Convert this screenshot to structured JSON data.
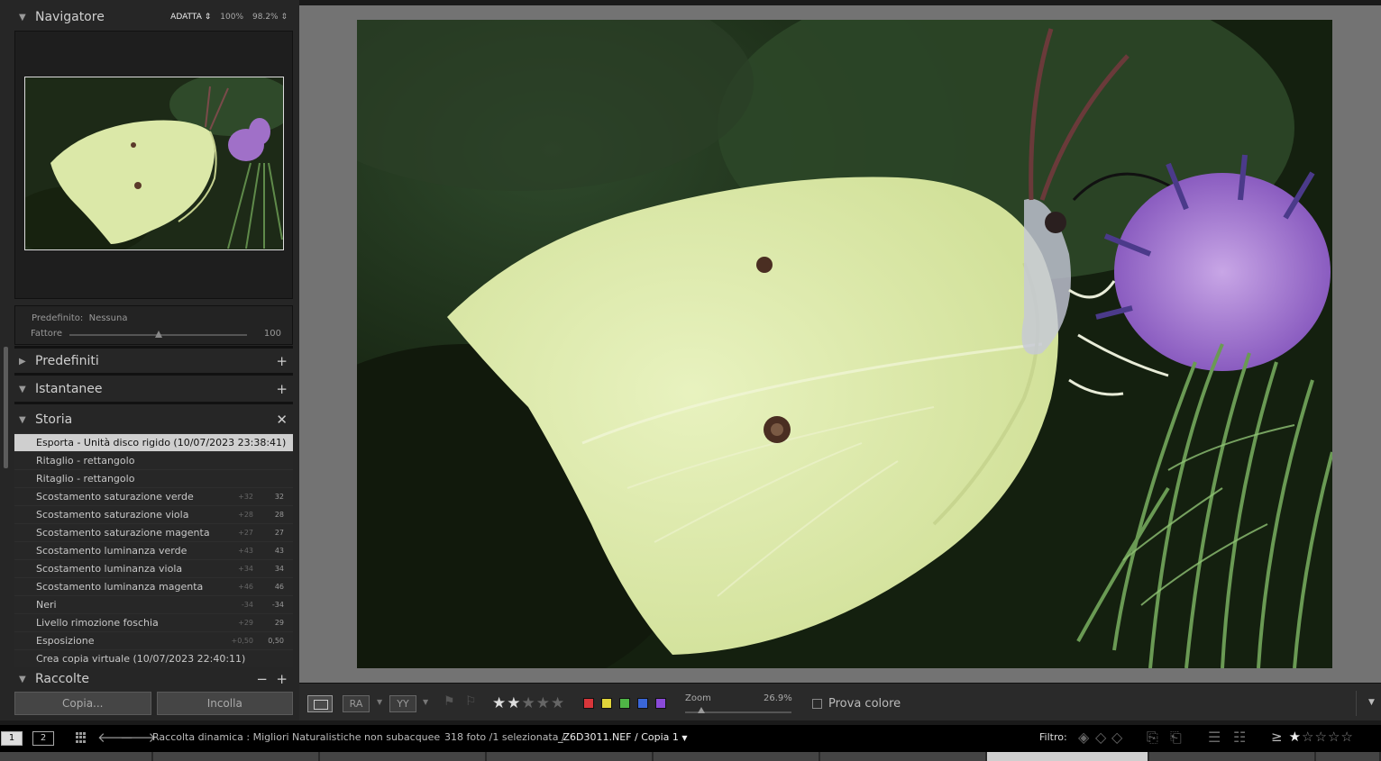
{
  "navigator": {
    "title": "Navigatore",
    "opt_fit": "ADATTA",
    "opt_100": "100%",
    "opt_zoom": "98.2%"
  },
  "preset_adjust": {
    "preset_label": "Predefinito:",
    "preset_value": "Nessuna",
    "amount_label": "Fattore",
    "amount_value": "100"
  },
  "panels": {
    "presets": "Predefiniti",
    "snapshots": "Istantanee",
    "history": "Storia",
    "collections": "Raccolte"
  },
  "history": [
    {
      "label": "Esporta - Unità disco rigido (10/07/2023 23:38:41)",
      "delta": "",
      "value": "",
      "selected": true
    },
    {
      "label": "Ritaglio - rettangolo",
      "delta": "",
      "value": ""
    },
    {
      "label": "Ritaglio - rettangolo",
      "delta": "",
      "value": ""
    },
    {
      "label": "Scostamento saturazione verde",
      "delta": "+32",
      "value": "32"
    },
    {
      "label": "Scostamento saturazione viola",
      "delta": "+28",
      "value": "28"
    },
    {
      "label": "Scostamento saturazione magenta",
      "delta": "+27",
      "value": "27"
    },
    {
      "label": "Scostamento luminanza verde",
      "delta": "+43",
      "value": "43"
    },
    {
      "label": "Scostamento luminanza viola",
      "delta": "+34",
      "value": "34"
    },
    {
      "label": "Scostamento luminanza magenta",
      "delta": "+46",
      "value": "46"
    },
    {
      "label": "Neri",
      "delta": "-34",
      "value": "-34"
    },
    {
      "label": "Livello rimozione foschia",
      "delta": "+29",
      "value": "29"
    },
    {
      "label": "Esposizione",
      "delta": "+0,50",
      "value": "0,50"
    },
    {
      "label": "Crea copia virtuale (10/07/2023 22:40:11)",
      "delta": "",
      "value": ""
    }
  ],
  "buttons": {
    "copy": "Copia...",
    "paste": "Incolla"
  },
  "toolbar": {
    "view_ra": "RA",
    "view_yy": "YY",
    "rating": 2,
    "rating_max": 5,
    "zoom_label": "Zoom",
    "zoom_value": "26.9%",
    "zoom_fraction": 0.15,
    "soft_proof": "Prova colore",
    "color_labels": [
      "#d8363a",
      "#e0d43a",
      "#4fb446",
      "#3a66d8",
      "#8a4ad8"
    ]
  },
  "filmstrip": {
    "monitor1": "1",
    "monitor2": "2",
    "source": "Raccolta dinamica : Migliori Naturalistiche non subacquee",
    "count": "318 foto /1 selezionata /",
    "filename": "_Z6D3011.NEF / Copia 1",
    "filter_label": "Filtro:",
    "filter_min_stars": 1,
    "filter_operator": "≥"
  },
  "icons": [
    "grid-icon",
    "arrow-left-icon",
    "arrow-right-icon",
    "flag-icon",
    "reject-flag-icon",
    "plus-icon",
    "close-icon",
    "chevron-down-icon"
  ]
}
